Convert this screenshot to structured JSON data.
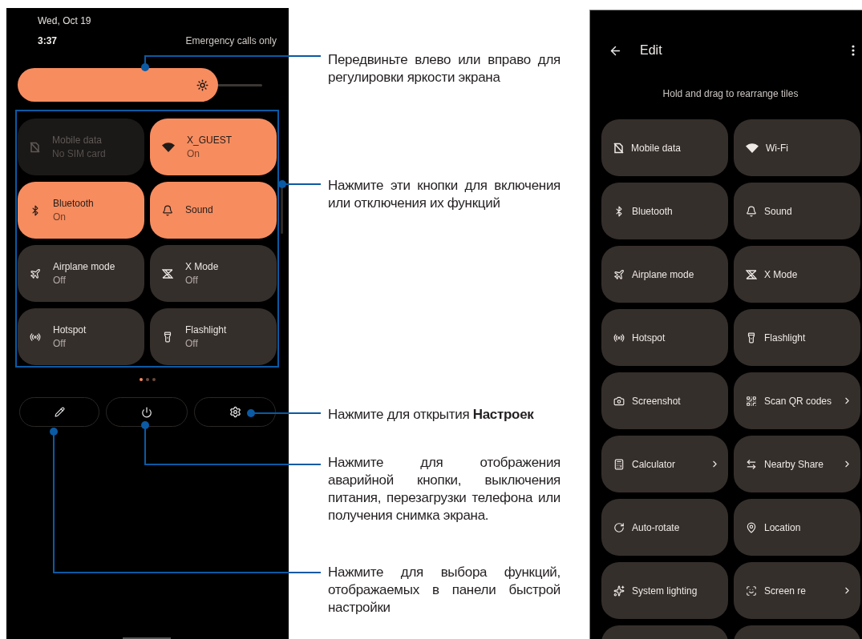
{
  "quick_settings": {
    "date": "Wed, Oct 19",
    "time": "3:37",
    "network_status": "Emergency calls only",
    "brightness": {
      "level": 0.82
    },
    "tiles": [
      {
        "label": "Mobile data",
        "status": "No SIM card",
        "on": false,
        "disabled": true
      },
      {
        "label": "X_GUEST",
        "status": "On",
        "on": true,
        "disabled": false
      },
      {
        "label": "Bluetooth",
        "status": "On",
        "on": true,
        "disabled": false
      },
      {
        "label": "Sound",
        "on": true,
        "disabled": false
      },
      {
        "label": "Airplane mode",
        "status": "Off",
        "on": false,
        "disabled": false
      },
      {
        "label": "X Mode",
        "status": "Off",
        "on": false,
        "disabled": false
      },
      {
        "label": "Hotspot",
        "status": "Off",
        "on": false,
        "disabled": false
      },
      {
        "label": "Flashlight",
        "status": "Off",
        "on": false,
        "disabled": false
      }
    ],
    "page_dots": [
      {
        "selected": true
      },
      {
        "selected": false
      },
      {
        "selected": false
      }
    ]
  },
  "annotations": [
    {
      "text": "Передвиньте влево или вправо для регулировки яркости экрана"
    },
    {
      "text": "Нажмите эти кнопки для включения или отключения их функций"
    },
    {
      "text": "Нажмите для открытия **Настроек**"
    },
    {
      "text": "Нажмите для отображения аварийной кнопки, выключения питания, перезагрузки телефона или получения снимка экрана."
    },
    {
      "text": "Нажмите для выбора функций, отображаемых в панели быстрой настройки"
    }
  ],
  "edit_screen": {
    "title": "Edit",
    "hint": "Hold and drag to rearrange tiles",
    "tiles": [
      {
        "label": "Mobile data",
        "chevron": false
      },
      {
        "label": "Wi-Fi",
        "chevron": false
      },
      {
        "label": "Bluetooth",
        "chevron": false
      },
      {
        "label": "Sound",
        "chevron": false
      },
      {
        "label": "Airplane mode",
        "chevron": false
      },
      {
        "label": "X Mode",
        "chevron": false
      },
      {
        "label": "Hotspot",
        "chevron": false
      },
      {
        "label": "Flashlight",
        "chevron": false
      },
      {
        "label": "Screenshot",
        "chevron": false
      },
      {
        "label": "Scan QR codes",
        "chevron": true
      },
      {
        "label": "Calculator",
        "chevron": true
      },
      {
        "label": "Nearby Share",
        "chevron": true
      },
      {
        "label": "Auto-rotate",
        "chevron": false
      },
      {
        "label": "Location",
        "chevron": false
      },
      {
        "label": "System lighting",
        "chevron": false
      },
      {
        "label": "Screen re",
        "chevron": true
      }
    ]
  }
}
